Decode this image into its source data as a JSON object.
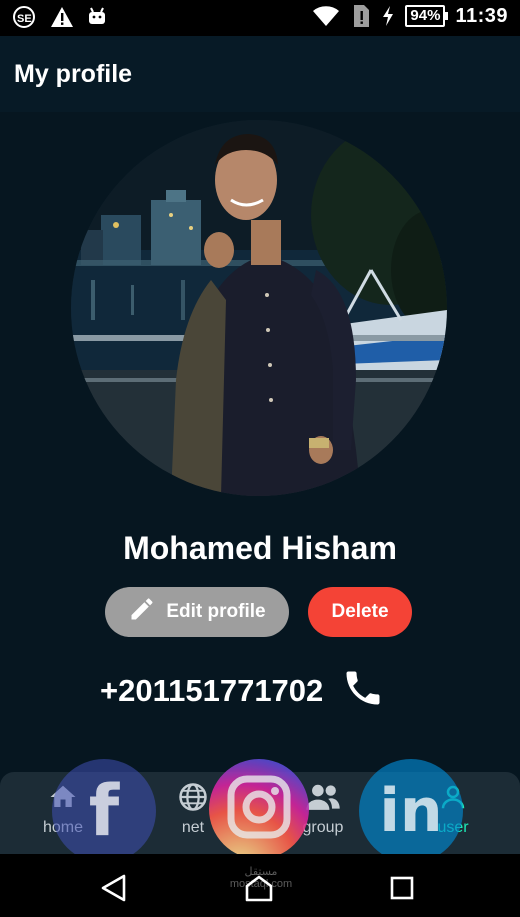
{
  "status_bar": {
    "time": "11:39",
    "battery": "94%",
    "left_icons": [
      "sim-se-icon",
      "warning-icon",
      "android-icon"
    ],
    "right_icons": [
      "wifi-icon",
      "sim-alert-icon",
      "charging-bolt-icon"
    ]
  },
  "app_bar": {
    "title": "My profile"
  },
  "profile": {
    "name": "Mohamed Hisham",
    "phone": "+201151771702"
  },
  "actions": {
    "edit_label": "Edit profile",
    "delete_label": "Delete"
  },
  "bottom_nav": {
    "items": [
      {
        "label": "home",
        "icon": "home-icon"
      },
      {
        "label": "net",
        "icon": "globe-icon"
      },
      {
        "label": "group",
        "icon": "group-icon"
      },
      {
        "label": "user",
        "icon": "user-icon",
        "active": true
      }
    ]
  },
  "social_links": [
    {
      "icon": "facebook-icon",
      "glyph": "f"
    },
    {
      "icon": "instagram-icon"
    },
    {
      "icon": "linkedin-icon",
      "glyph": "in"
    }
  ],
  "watermark": {
    "line1": "مستقل",
    "line2": "mostaql.com"
  },
  "colors": {
    "background": "#061620",
    "accent": "#1de9b6",
    "delete": "#f44336",
    "edit": "#9e9e9e"
  }
}
